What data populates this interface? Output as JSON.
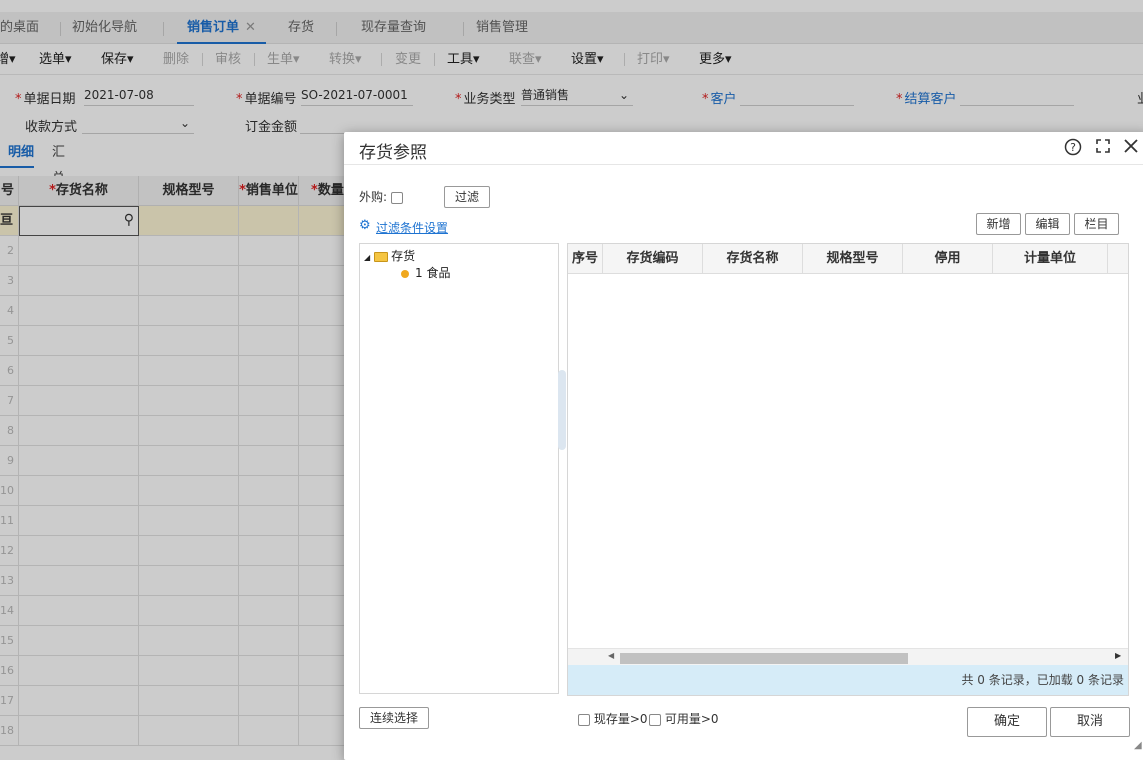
{
  "tabs": {
    "t1": "的桌面",
    "t2": "初始化导航",
    "t3": "销售订单",
    "t3_close": "✕",
    "t4": "存货",
    "t5": "现存量查询",
    "t6": "销售管理"
  },
  "toolbar": {
    "b0": "增▾",
    "b1": "选单▾",
    "b2": "保存▾",
    "b3": "删除",
    "b4": "审核",
    "b5": "生单▾",
    "b6": "转换▾",
    "b7": "变更",
    "b8": "工具▾",
    "b9": "联查▾",
    "b10": "设置▾",
    "b11": "打印▾",
    "b12": "更多▾"
  },
  "form": {
    "date_label": "单据日期",
    "date_value": "2021-07-08",
    "no_label": "单据编号",
    "no_value": "SO-2021-07-0001",
    "biz_label": "业务类型",
    "biz_value": "普通销售",
    "customer_label": "客户",
    "settle_label": "结算客户",
    "edge_label": "业",
    "pay_label": "收款方式",
    "deposit_label": "订金金额"
  },
  "subtabs": {
    "detail": "明细",
    "summary": "汇总"
  },
  "grid": {
    "headers": {
      "rownum": "号",
      "name": "存货名称",
      "spec": "规格型号",
      "unit": "销售单位",
      "qty": "数量"
    },
    "first_cell": "亘",
    "rows": [
      "2",
      "3",
      "4",
      "5",
      "6",
      "7",
      "8",
      "9",
      "10",
      "11",
      "12",
      "13",
      "14",
      "15",
      "16",
      "17",
      "18"
    ]
  },
  "dialog": {
    "title": "存货参照",
    "purchase_label": "外购:",
    "filter_btn": "过滤",
    "filter_settings": "过滤条件设置",
    "new_btn": "新增",
    "edit_btn": "编辑",
    "cols_btn": "栏目",
    "tree_root": "存货",
    "tree_child": "1 食品",
    "columns": {
      "c1": "序号",
      "c2": "存货编码",
      "c3": "存货名称",
      "c4": "规格型号",
      "c5": "停用",
      "c6": "计量单位"
    },
    "status": "共 0 条记录，已加载 0 条记录",
    "continuous_btn": "连续选择",
    "stock_chk": "现存量>0",
    "avail_chk": "可用量>0",
    "ok_btn": "确定",
    "cancel_btn": "取消"
  },
  "colors": {
    "accent": "#1e73d1",
    "required": "#e02020",
    "status_bg": "#d6ecf8"
  }
}
